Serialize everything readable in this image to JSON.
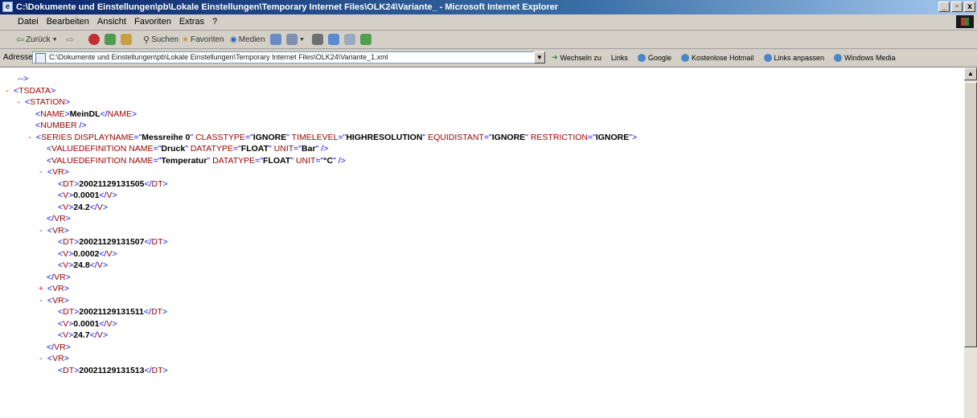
{
  "window": {
    "title": "C:\\Dokumente und Einstellungen\\pb\\Lokale Einstellungen\\Temporary Internet Files\\OLK24\\Variante_ - Microsoft Internet Explorer",
    "min_label": "_",
    "max_label": "̈",
    "close_label": "x"
  },
  "menu": [
    "Datei",
    "Bearbeiten",
    "Ansicht",
    "Favoriten",
    "Extras",
    "?"
  ],
  "toolbar": {
    "back_label": "Zurück",
    "search_label": "Suchen",
    "favorites_label": "Favoriten",
    "media_label": "Medien"
  },
  "address": {
    "label": "Adresse",
    "url": "C:\\Dokumente und Einstellungen\\pb\\Lokale Einstellungen\\Temporary Internet Files\\OLK24\\Variante_1.xml",
    "go_label": "Wechseln zu",
    "links_label": "Links",
    "links": [
      "Google",
      "Kostenlose Hotmail",
      "Links anpassen",
      "Windows Media"
    ]
  },
  "xml": {
    "comment_end": "-->",
    "tsdata": "TSDATA",
    "station": "STATION",
    "name_tag": "NAME",
    "name_value": "MeinDL",
    "number_tag": "NUMBER",
    "series": {
      "tag": "SERIES",
      "displayname_attr": "DISPLAYNAME",
      "displayname": "Messreihe 0",
      "classtype_attr": "CLASSTYPE",
      "classtype": "IGNORE",
      "timelevel_attr": "TIMELEVEL",
      "timelevel": "HIGHRESOLUTION",
      "equidistant_attr": "EQUIDISTANT",
      "equidistant": "IGNORE",
      "restriction_attr": "RESTRICTION",
      "restriction": "IGNORE"
    },
    "valuedefs": [
      {
        "name": "Druck",
        "datatype": "FLOAT",
        "unit": "Bar"
      },
      {
        "name": "Temperatur",
        "datatype": "FLOAT",
        "unit": "°C"
      }
    ],
    "vr_tag": "VR",
    "dt_tag": "DT",
    "v_tag": "V",
    "valuedef_tag": "VALUEDEFINITION",
    "name_attr": "NAME",
    "datatype_attr": "DATATYPE",
    "unit_attr": "UNIT",
    "records": [
      {
        "dt": "20021129131505",
        "v1": "0.0001",
        "v2": "24.2"
      },
      {
        "dt": "20021129131507",
        "v1": "0.0002",
        "v2": "24.8"
      },
      {
        "dt": "20021129131511",
        "v1": "0.0001",
        "v2": "24.7"
      }
    ],
    "last_dt": "20021129131513"
  }
}
